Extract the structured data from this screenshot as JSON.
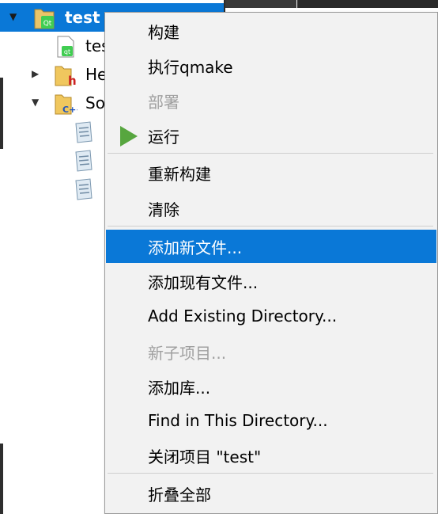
{
  "tree": {
    "items": [
      {
        "label": "test",
        "selected": true,
        "expanded": true,
        "icon": "qt-project-icon"
      },
      {
        "label": "tes",
        "icon": "qt-file-icon"
      },
      {
        "label": "He",
        "expanded": false,
        "icon": "headers-folder-icon"
      },
      {
        "label": "So",
        "expanded": true,
        "icon": "sources-folder-icon"
      },
      {
        "label": "",
        "icon": "cpp-file-icon"
      },
      {
        "label": "",
        "icon": "cpp-file-icon"
      },
      {
        "label": "",
        "icon": "cpp-file-icon"
      }
    ]
  },
  "menu": {
    "items": [
      {
        "label": "构建",
        "enabled": true
      },
      {
        "label": "执行qmake",
        "enabled": true
      },
      {
        "label": "部署",
        "enabled": false
      },
      {
        "label": "运行",
        "enabled": true,
        "icon": "run-icon"
      },
      {
        "label": "重新构建",
        "enabled": true
      },
      {
        "label": "清除",
        "enabled": true
      },
      {
        "label": "添加新文件...",
        "enabled": true,
        "highlighted": true
      },
      {
        "label": "添加现有文件...",
        "enabled": true
      },
      {
        "label": "Add Existing Directory...",
        "enabled": true
      },
      {
        "label": "新子项目...",
        "enabled": false
      },
      {
        "label": "添加库...",
        "enabled": true
      },
      {
        "label": "Find in This Directory...",
        "enabled": true
      },
      {
        "label": "关闭项目 \"test\"",
        "enabled": true
      },
      {
        "label": "折叠全部",
        "enabled": true
      }
    ]
  },
  "colors": {
    "selection": "#0a78d7",
    "menu_bg": "#f2f2f2",
    "disabled_text": "#a0a0a0",
    "run_green": "#57a63f"
  }
}
